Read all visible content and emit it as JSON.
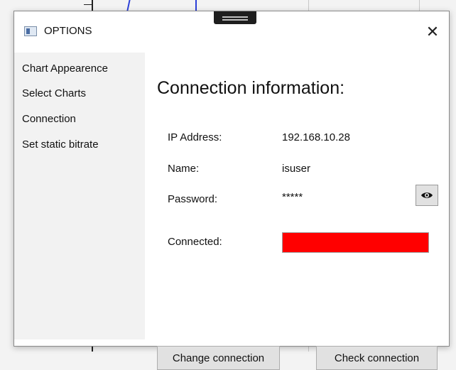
{
  "window": {
    "title": "OPTIONS",
    "close_symbol": "✕"
  },
  "sidebar": {
    "items": [
      {
        "label": "Chart Appearence"
      },
      {
        "label": "Select Charts"
      },
      {
        "label": "Connection"
      },
      {
        "label": "Set static bitrate"
      }
    ]
  },
  "connection": {
    "heading": "Connection information:",
    "ip_label": "IP Address:",
    "ip_value": "192.168.10.28",
    "name_label": "Name:",
    "name_value": "isuser",
    "password_label": "Password:",
    "password_value": "*****",
    "show_password_icon": "eye-icon",
    "connected_label": "Connected:",
    "connected_status_color": "#ff0000"
  },
  "buttons": {
    "change_connection": "Change connection",
    "check_connection": "Check connection"
  }
}
